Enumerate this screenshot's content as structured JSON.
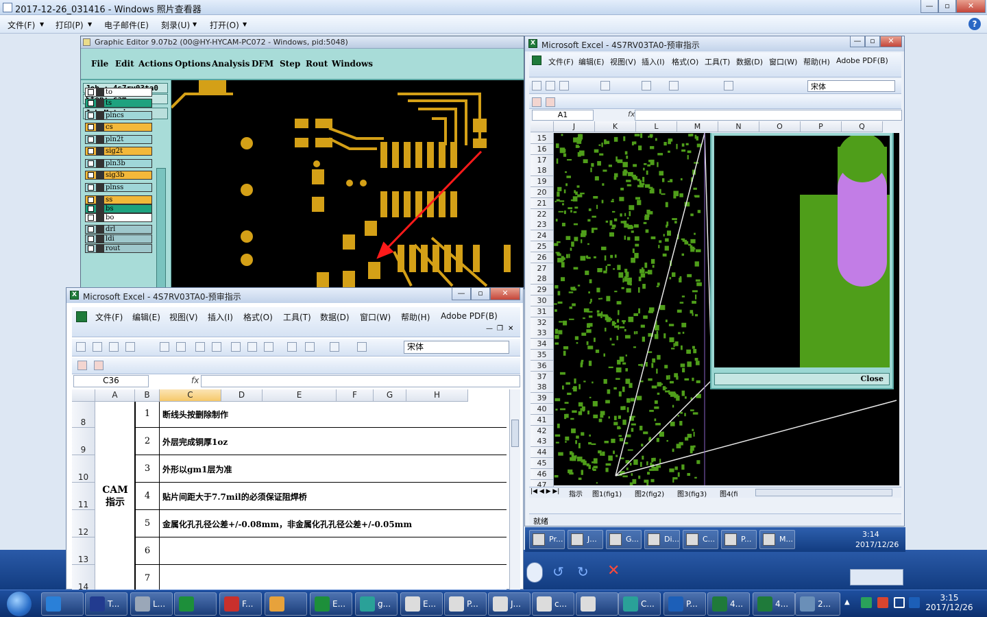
{
  "viewer": {
    "title": "2017-12-26_031416 - Windows 照片查看器",
    "menu": [
      "文件(F)",
      "打印(P)",
      "电子邮件(E)",
      "刻录(U)",
      "打开(O)"
    ]
  },
  "graphic_editor": {
    "title": "Graphic Editor 9.07b2 (00@HY-HYCAM-PC072 - Windows, pid:5048)",
    "menu": [
      "File",
      "Edit",
      "Actions",
      "Options",
      "Analysis",
      "DFM",
      "Step",
      "Rout",
      "Windows"
    ],
    "job_label": "Job : 4s7rv03ta0",
    "step_label": "Step: cam",
    "matrix_button": "Job Matrix ...",
    "layers": [
      {
        "name": "to",
        "color": "#ffffff"
      },
      {
        "name": "ts",
        "color": "#1ea27f"
      },
      {
        "name": "plncs",
        "color": "#9fd6d8"
      },
      {
        "name": "cs",
        "color": "#f3b83a"
      },
      {
        "name": "pln2t",
        "color": "#9fd6d8"
      },
      {
        "name": "sig2t",
        "color": "#f3b83a"
      },
      {
        "name": "pln3b",
        "color": "#9fd6d8"
      },
      {
        "name": "sig3b",
        "color": "#f3b83a"
      },
      {
        "name": "plnss",
        "color": "#9fd6d8"
      },
      {
        "name": "ss",
        "color": "#f3b83a"
      },
      {
        "name": "bs",
        "color": "#1ea27f"
      },
      {
        "name": "bo",
        "color": "#ffffff"
      },
      {
        "name": "drl",
        "color": "#9fc8cc"
      },
      {
        "name": "ldi",
        "color": "#9fc8cc"
      },
      {
        "name": "rout",
        "color": "#9fc8cc"
      }
    ]
  },
  "excel_front": {
    "title": "Microsoft Excel - 4S7RV03TA0-预审指示",
    "menu": [
      "文件(F)",
      "编辑(E)",
      "视图(V)",
      "插入(I)",
      "格式(O)",
      "工具(T)",
      "数据(D)",
      "窗口(W)",
      "帮助(H)",
      "Adobe PDF(B)"
    ],
    "font_name": "宋体",
    "cell_ref": "C36",
    "fx": "fx",
    "columns": [
      "A",
      "B",
      "C",
      "D",
      "E",
      "F",
      "G",
      "H"
    ],
    "rows": [
      "8",
      "9",
      "10",
      "11",
      "12",
      "13",
      "14"
    ],
    "category": "CAM\n指示",
    "items": [
      {
        "n": "1",
        "text": "断线头按删除制作"
      },
      {
        "n": "2",
        "text": "外层完成铜厚1oz"
      },
      {
        "n": "3",
        "text": "外形以gm1层为准"
      },
      {
        "n": "4",
        "text": "贴片间距大于7.7mil的必须保证阻焊桥"
      },
      {
        "n": "5",
        "text": "金属化孔孔径公差+/-0.08mm，非金属化孔孔径公差+/-0.05mm"
      },
      {
        "n": "6",
        "text": ""
      },
      {
        "n": "7",
        "text": ""
      }
    ]
  },
  "excel_back": {
    "title": "Microsoft Excel - 4S7RV03TA0-预审指示",
    "menu": [
      "文件(F)",
      "编辑(E)",
      "视图(V)",
      "插入(I)",
      "格式(O)",
      "工具(T)",
      "数据(D)",
      "窗口(W)",
      "帮助(H)",
      "Adobe PDF(B)"
    ],
    "font_name": "宋体",
    "cell_ref": "A1",
    "fx": "fx",
    "columns": [
      "J",
      "K",
      "L",
      "M",
      "N",
      "O",
      "P",
      "Q"
    ],
    "rows": [
      "15",
      "16",
      "17",
      "18",
      "19",
      "20",
      "21",
      "22",
      "23",
      "24",
      "25",
      "26",
      "27",
      "28",
      "29",
      "30",
      "31",
      "32",
      "33",
      "34",
      "35",
      "36",
      "37",
      "38",
      "39",
      "40",
      "41",
      "42",
      "43",
      "44",
      "45",
      "46",
      "47"
    ],
    "sheet_tabs": [
      "指示",
      "图1(fig1)",
      "图2(fig2)",
      "图3(fig3)",
      "图4(fi"
    ],
    "status": "就绪",
    "close_label": "Close",
    "mini_tasks": [
      "Pr...",
      "J...",
      "G...",
      "Di...",
      "C...",
      "P...",
      "M..."
    ],
    "mini_clock_time": "3:14",
    "mini_clock_date": "2017/12/26"
  },
  "taskbar": {
    "items": [
      {
        "label": "",
        "color": "#2a80d8",
        "icon": "ie-icon"
      },
      {
        "label": "T...",
        "color": "#223b8f",
        "icon": "save-icon"
      },
      {
        "label": "L...",
        "color": "#9aa7b8",
        "icon": "keyboard-icon"
      },
      {
        "label": "",
        "color": "#1d8f3a",
        "icon": "f-icon"
      },
      {
        "label": "F...",
        "color": "#c9302c",
        "icon": "g-icon"
      },
      {
        "label": "",
        "color": "#e7a23b",
        "icon": "shell-icon"
      },
      {
        "label": "E...",
        "color": "#1d8f3a",
        "icon": "f-icon"
      },
      {
        "label": "g...",
        "color": "#2aa198",
        "icon": "eye-icon"
      },
      {
        "label": "E...",
        "color": "#dcdcdc",
        "icon": "x-icon"
      },
      {
        "label": "P...",
        "color": "#dcdcdc",
        "icon": "x-icon"
      },
      {
        "label": "J...",
        "color": "#dcdcdc",
        "icon": "x-icon"
      },
      {
        "label": "c...",
        "color": "#dcdcdc",
        "icon": "x-icon"
      },
      {
        "label": "",
        "color": "#dcdcdc",
        "icon": "x-icon"
      },
      {
        "label": "C...",
        "color": "#2aa198",
        "icon": "eye-icon"
      },
      {
        "label": "P...",
        "color": "#1c5fb8",
        "icon": "f-icon"
      },
      {
        "label": "4...",
        "color": "#1f7a3a",
        "icon": "excel-icon"
      },
      {
        "label": "4...",
        "color": "#1f7a3a",
        "icon": "excel-icon"
      },
      {
        "label": "2...",
        "color": "#6a8fb8",
        "icon": "photo-icon"
      }
    ],
    "clock_time": "3:15",
    "clock_date": "2017/12/26"
  }
}
